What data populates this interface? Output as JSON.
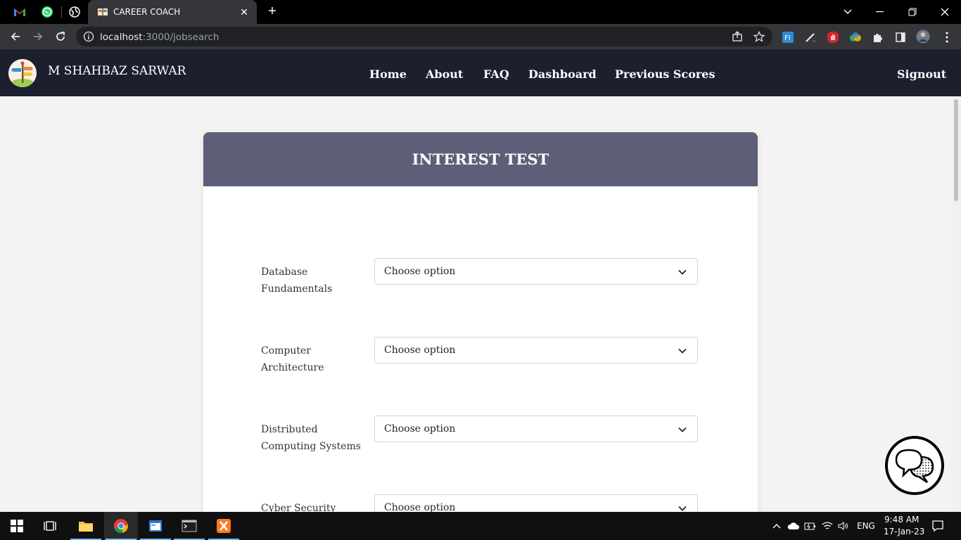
{
  "browser": {
    "tab_title": "CAREER COACH",
    "url_host": "localhost",
    "url_path": ":3000/jobsearch",
    "extension_label": "FI"
  },
  "app": {
    "brand": "M SHAHBAZ SARWAR",
    "nav": {
      "home": "Home",
      "about": "About",
      "faq": "FAQ",
      "dashboard": "Dashboard",
      "previous_scores": "Previous Scores",
      "signout": "Signout"
    }
  },
  "card": {
    "title": "INTEREST TEST",
    "rows": [
      {
        "label": "Database Fundamentals",
        "value": "Choose option"
      },
      {
        "label": "Computer Architecture",
        "value": "Choose option"
      },
      {
        "label": "Distributed Computing Systems",
        "value": "Choose option"
      },
      {
        "label": "Cyber Security",
        "value": "Choose option"
      }
    ]
  },
  "taskbar": {
    "language": "ENG",
    "time": "9:48 AM",
    "date": "17-Jan-23"
  },
  "colors": {
    "nav_bg": "#1c1f2e",
    "card_header_bg": "#5c5f77",
    "page_bg": "#f3f3f3"
  }
}
